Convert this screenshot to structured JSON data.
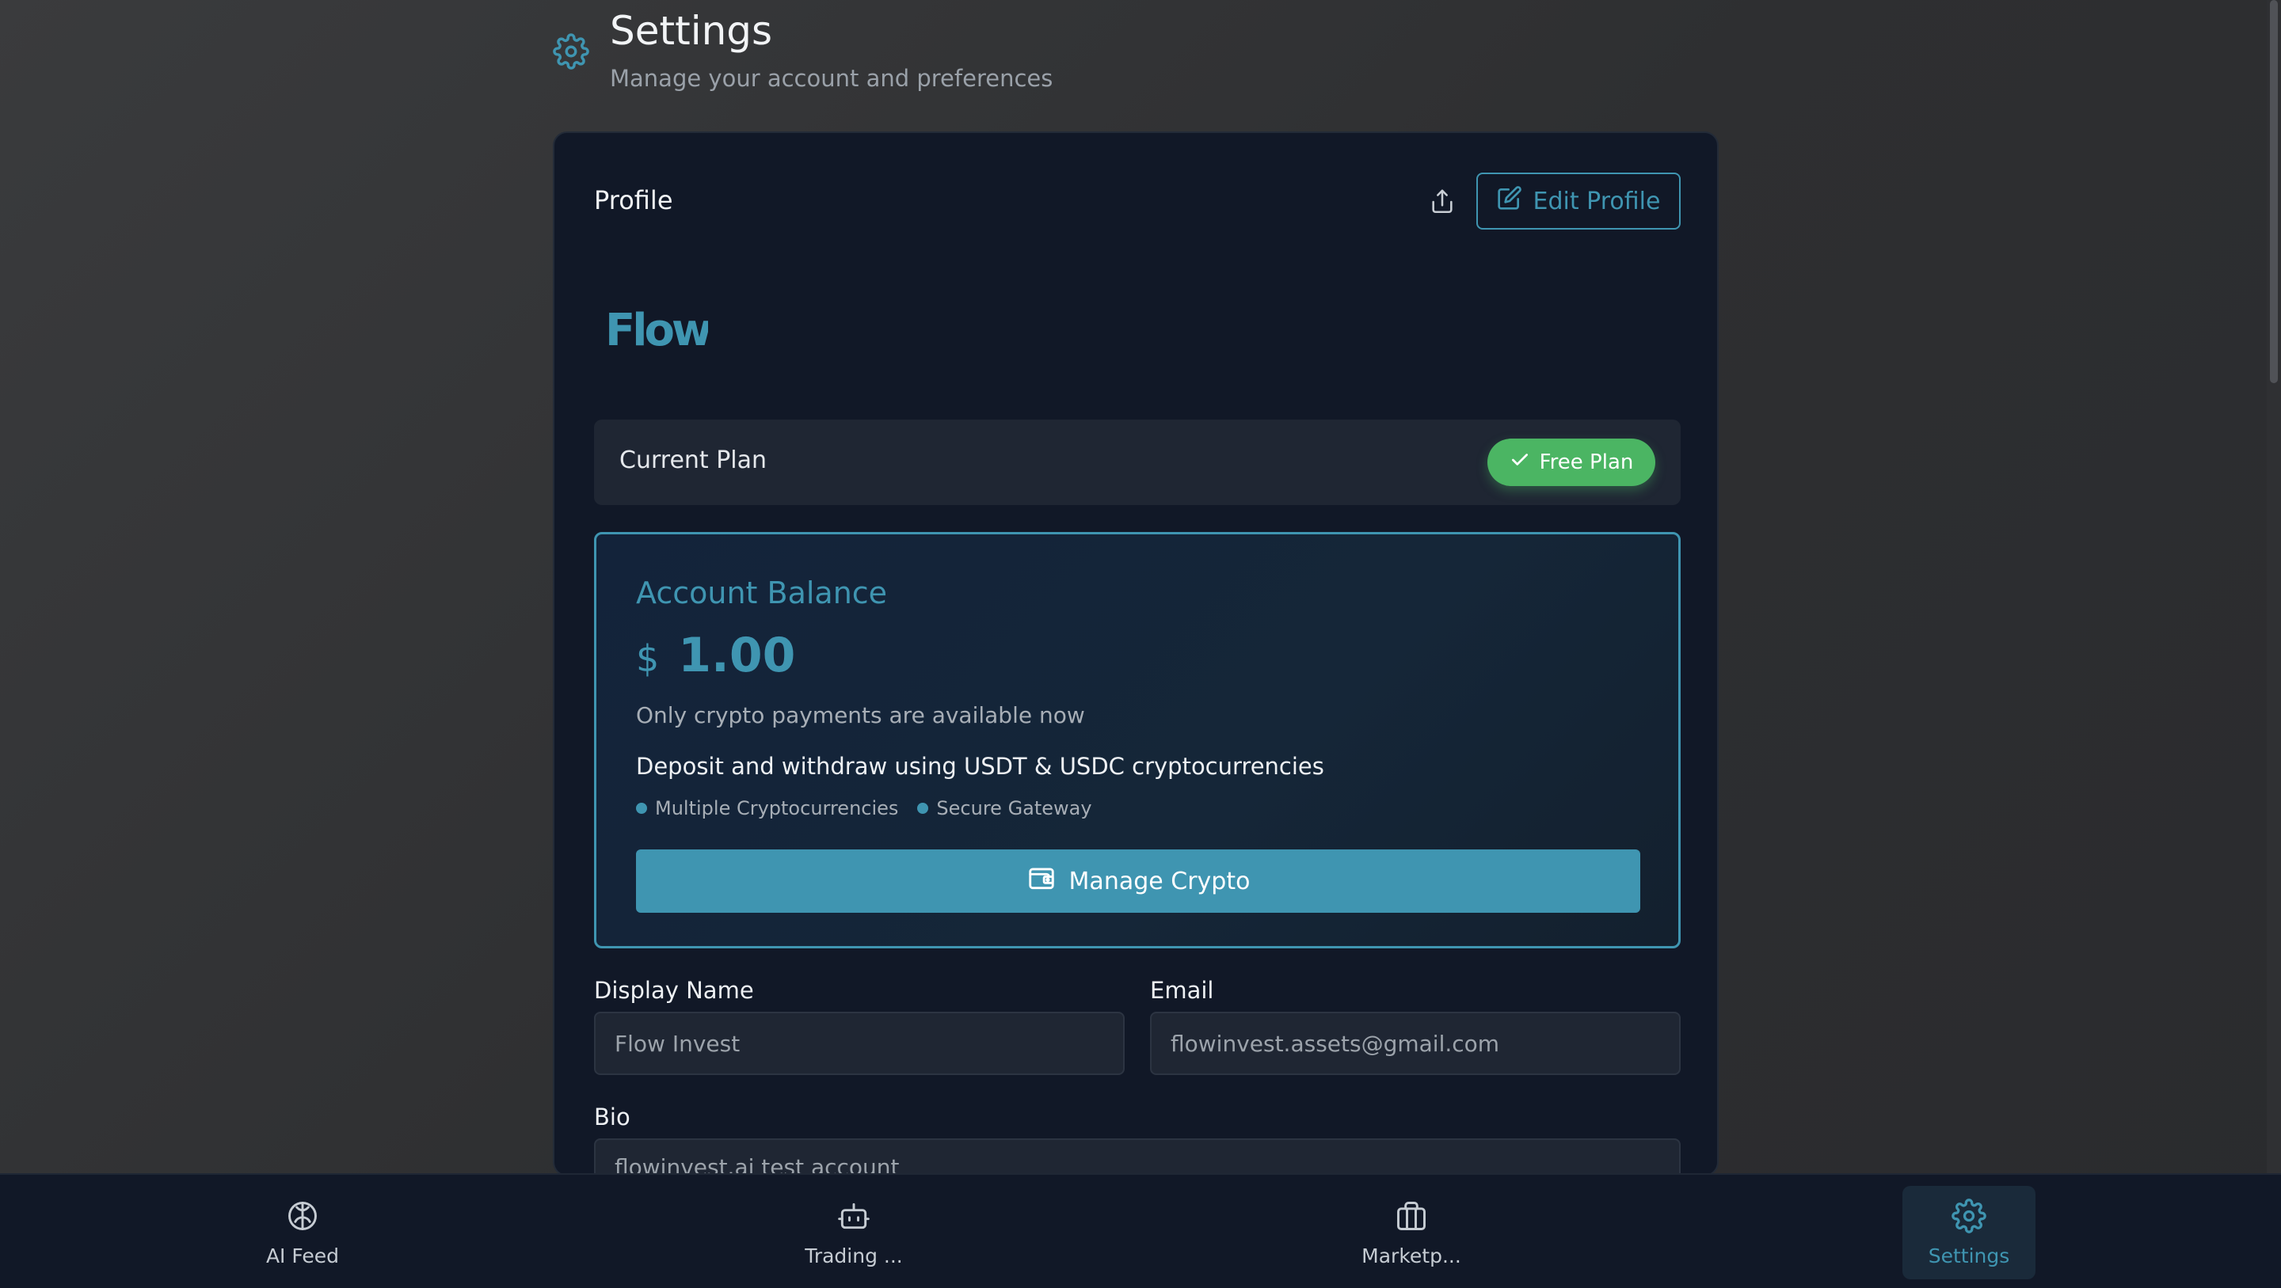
{
  "header": {
    "title": "Settings",
    "subtitle": "Manage your account and preferences",
    "icon": "gear-icon"
  },
  "profile": {
    "title": "Profile",
    "edit_label": "Edit Profile",
    "logo_text": "Flow"
  },
  "plan": {
    "label": "Current Plan",
    "badge": "Free Plan",
    "badge_color": "#4bb563"
  },
  "balance": {
    "title": "Account Balance",
    "currency": "$",
    "amount": "1.00",
    "note": "Only crypto payments are available now",
    "deposit_text": "Deposit and withdraw using USDT & USDC cryptocurrencies",
    "features": [
      "Multiple Cryptocurrencies",
      "Secure Gateway"
    ],
    "manage_label": "Manage Crypto",
    "accent_color": "#3f95b1"
  },
  "form": {
    "display_name_label": "Display Name",
    "display_name_value": "Flow Invest",
    "email_label": "Email",
    "email_value": "flowinvest.assets@gmail.com",
    "bio_label": "Bio",
    "bio_value": "flowinvest.ai test account"
  },
  "nav": {
    "items": [
      {
        "label": "AI Feed",
        "icon": "brain-icon"
      },
      {
        "label": "Trading ...",
        "icon": "bot-icon"
      },
      {
        "label": "Marketp...",
        "icon": "briefcase-icon"
      },
      {
        "label": "Settings",
        "icon": "gear-icon",
        "active": true
      }
    ]
  }
}
